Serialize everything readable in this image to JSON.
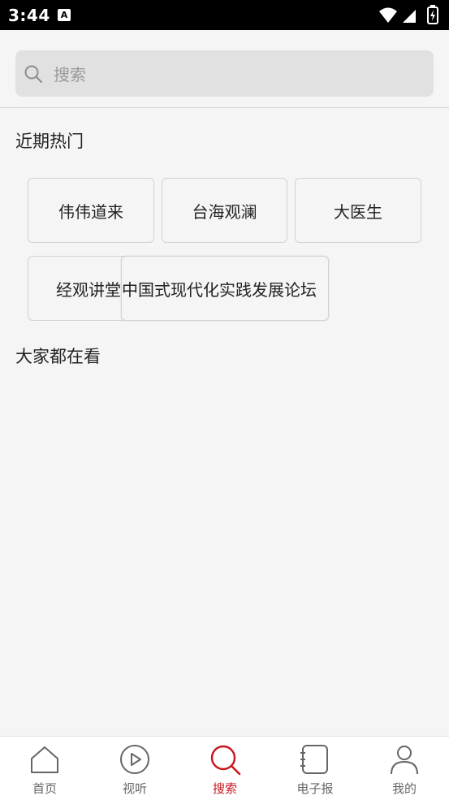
{
  "status_bar": {
    "time": "3:44",
    "app_icon_letter": "A"
  },
  "search": {
    "placeholder": "搜索",
    "value": ""
  },
  "recent_hot": {
    "title": "近期热门",
    "tags": [
      "伟伟道来",
      "台海观澜",
      "大医生",
      "经观讲堂",
      "中国式现代化实践发展论坛"
    ]
  },
  "everyone_watching": {
    "title": "大家都在看"
  },
  "bottom_nav": {
    "active_color": "#c8161e",
    "items": [
      {
        "label": "首页",
        "icon": "home-icon"
      },
      {
        "label": "视听",
        "icon": "play-icon"
      },
      {
        "label": "搜索",
        "icon": "search-icon"
      },
      {
        "label": "电子报",
        "icon": "newspaper-icon"
      },
      {
        "label": "我的",
        "icon": "user-icon"
      }
    ]
  }
}
